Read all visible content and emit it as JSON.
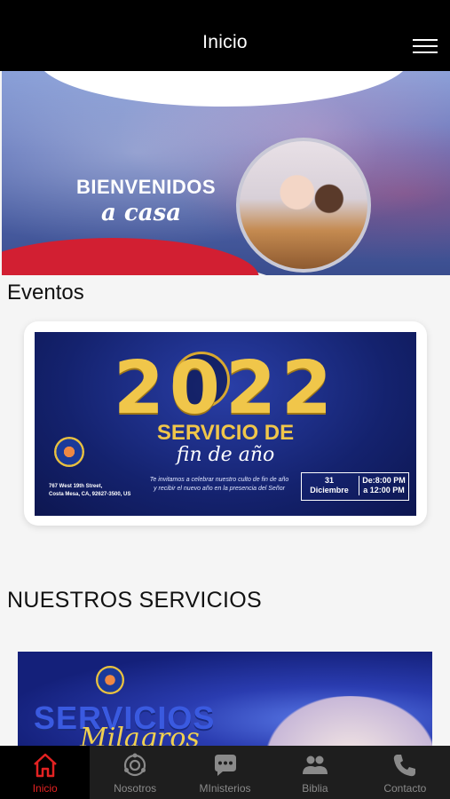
{
  "header": {
    "title": "Inicio",
    "menu_icon": "hamburger-menu-icon"
  },
  "hero": {
    "line1": "BIENVENIDOS",
    "line2": "a casa"
  },
  "events": {
    "title": "Eventos",
    "card": {
      "year": "2022",
      "service": "SERVICIO DE",
      "service_script": "fin de año",
      "invite_line1": "Te invitamos a celebrar nuestro culto de fin de año",
      "invite_line2": "y recibir el nuevo año en la presencia del Señor",
      "address_line1": "767 West 19th Street,",
      "address_line2": "Costa Mesa, CA, 92627-3500, US",
      "date_day": "31",
      "date_month": "Diciembre",
      "time_from": "De:8:00 PM",
      "time_to": "a 12:00 PM"
    }
  },
  "services": {
    "title": "NUESTROS SERVICIOS",
    "banner_big": "SERVICIOS",
    "banner_script": "Milagros"
  },
  "tabs": [
    {
      "label": "Inicio",
      "icon": "home-icon",
      "active": true
    },
    {
      "label": "Nosotros",
      "icon": "community-icon",
      "active": false
    },
    {
      "label": "MInisterios",
      "icon": "chat-bubble-icon",
      "active": false
    },
    {
      "label": "Biblia",
      "icon": "group-icon",
      "active": false
    },
    {
      "label": "Contacto",
      "icon": "phone-icon",
      "active": false
    }
  ],
  "colors": {
    "accent": "#e32222",
    "header_bg": "#000000",
    "tabbar_bg": "#1e1e1e",
    "inactive": "#8a8a8a"
  }
}
